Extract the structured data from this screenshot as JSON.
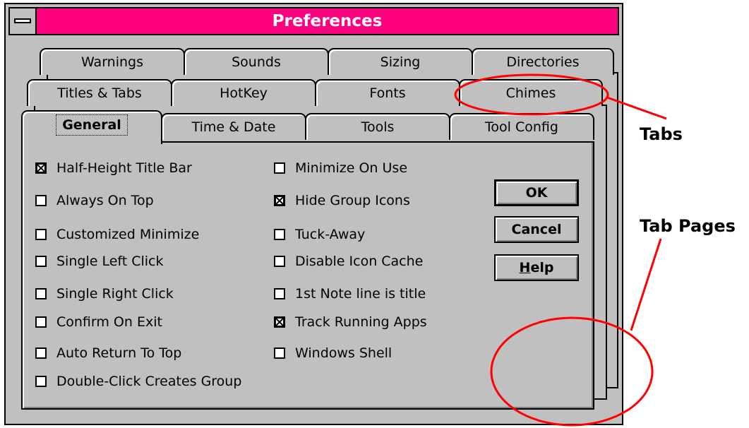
{
  "window": {
    "title": "Preferences"
  },
  "tabs": {
    "row1": [
      "Warnings",
      "Sounds",
      "Sizing",
      "Directories"
    ],
    "row2": [
      "Titles & Tabs",
      "HotKey",
      "Fonts",
      "Chimes"
    ],
    "row3": [
      "General",
      "Time & Date",
      "Tools",
      "Tool Config"
    ],
    "active": "General"
  },
  "options_left": [
    {
      "label": "Half-Height Title Bar",
      "checked": true
    },
    {
      "label": "Always On Top",
      "checked": false
    },
    {
      "label": "Customized Minimize",
      "checked": false
    },
    {
      "label": "Single Left Click",
      "checked": false
    },
    {
      "label": "Single Right Click",
      "checked": false
    },
    {
      "label": "Confirm On Exit",
      "checked": false
    },
    {
      "label": "Auto Return To Top",
      "checked": false
    },
    {
      "label": "Double-Click Creates Group",
      "checked": false
    }
  ],
  "options_right": [
    {
      "label": "Minimize On Use",
      "checked": false
    },
    {
      "label": "Hide Group Icons",
      "checked": true
    },
    {
      "label": "Tuck-Away",
      "checked": false
    },
    {
      "label": "Disable Icon Cache",
      "checked": false
    },
    {
      "label": "1st Note line is title",
      "checked": false
    },
    {
      "label": "Track Running Apps",
      "checked": true
    },
    {
      "label": "Windows Shell",
      "checked": false
    }
  ],
  "buttons": {
    "ok": "OK",
    "cancel": "Cancel",
    "help_underlined": "H",
    "help_rest": "elp"
  },
  "annotations": {
    "tabs_label": "Tabs",
    "tab_pages_label": "Tab Pages",
    "color": "#ff0000"
  },
  "colors": {
    "titlebar": "#ff0080",
    "face": "#c0c0c0"
  }
}
